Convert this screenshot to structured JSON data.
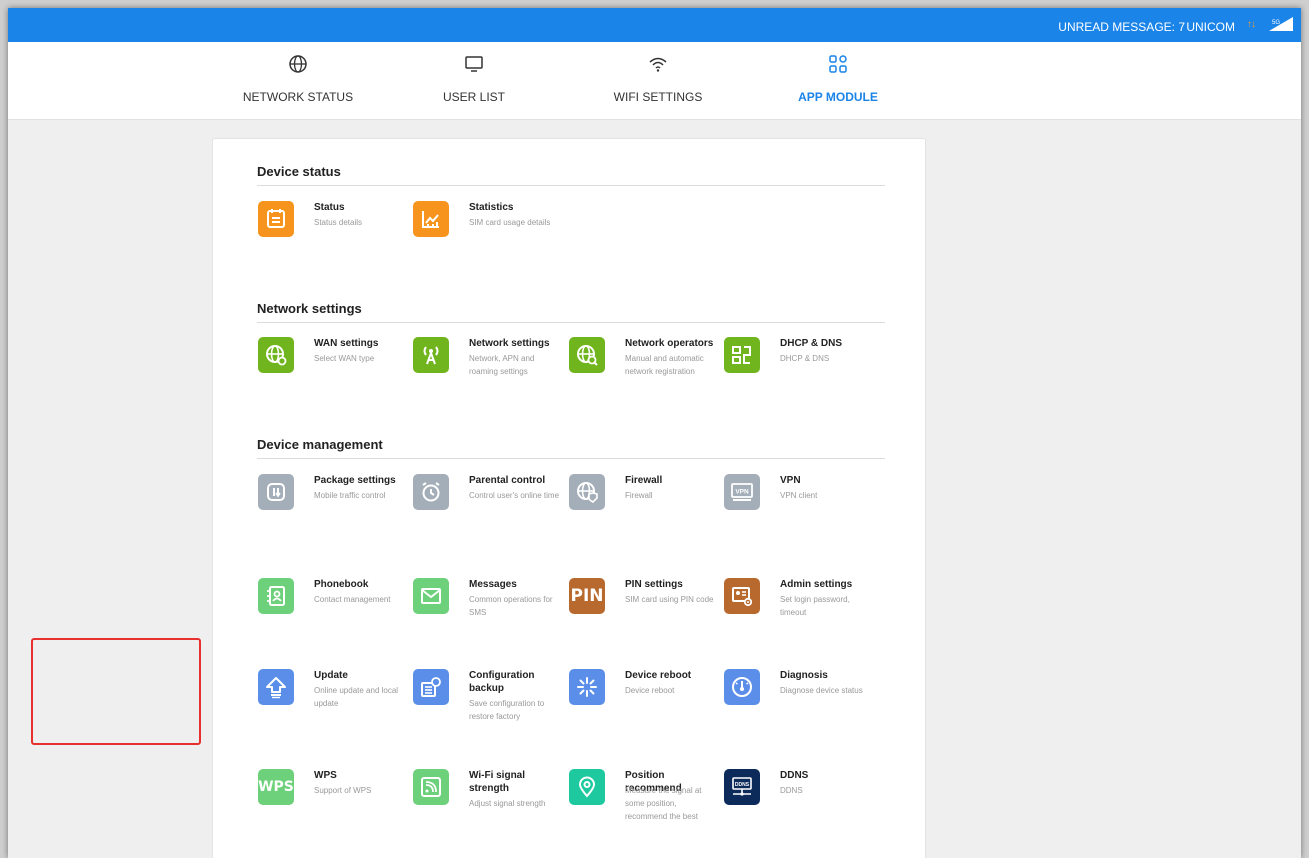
{
  "topbar": {
    "unread_message": "UNREAD MESSAGE: 7",
    "carrier": "UNICOM",
    "network_type": "5G",
    "bg_color": "#1a84e8"
  },
  "nav": {
    "items": [
      {
        "label": "NETWORK STATUS",
        "icon": "globe-icon",
        "active": false
      },
      {
        "label": "USER LIST",
        "icon": "monitor-icon",
        "active": false
      },
      {
        "label": "WIFI SETTINGS",
        "icon": "wifi-icon",
        "active": false
      },
      {
        "label": "APP MODULE",
        "icon": "app-grid-icon",
        "active": true
      }
    ]
  },
  "sections": [
    {
      "title": "Device status",
      "apps": [
        {
          "title": "Status",
          "desc": "Status details",
          "icon": "calendar-list-icon",
          "color": "#f7941d"
        },
        {
          "title": "Statistics",
          "desc": "SIM card usage details",
          "icon": "chart-icon",
          "color": "#f7941d"
        }
      ]
    },
    {
      "title": "Network settings",
      "apps": [
        {
          "title": "WAN settings",
          "desc": "Select WAN type",
          "icon": "globe-settings-icon",
          "color": "#70b41e"
        },
        {
          "title": "Network settings",
          "desc": "Network, APN and roaming settings",
          "icon": "antenna-icon",
          "color": "#70b41e"
        },
        {
          "title": "Network operators",
          "desc": "Manual and automatic network registration",
          "icon": "globe-search-icon",
          "color": "#70b41e"
        },
        {
          "title": "DHCP & DNS",
          "desc": "DHCP & DNS",
          "icon": "dhcp-icon",
          "color": "#70b41e"
        }
      ]
    },
    {
      "title": "Device management",
      "apps": [
        {
          "title": "Package settings",
          "desc": "Mobile traffic control",
          "icon": "package-icon",
          "color": "#a4aeb8"
        },
        {
          "title": "Parental control",
          "desc": "Control user's online time",
          "icon": "alarm-clock-icon",
          "color": "#a4aeb8"
        },
        {
          "title": "Firewall",
          "desc": "Firewall",
          "icon": "firewall-icon",
          "color": "#a4aeb8"
        },
        {
          "title": "VPN",
          "desc": "VPN client",
          "icon": "vpn-icon",
          "color": "#a4aeb8",
          "badge": "VPN"
        },
        {
          "title": "Phonebook",
          "desc": "Contact management",
          "icon": "phonebook-icon",
          "color": "#6dd07a"
        },
        {
          "title": "Messages",
          "desc": "Common operations for SMS",
          "icon": "envelope-icon",
          "color": "#6dd07a"
        },
        {
          "title": "PIN settings",
          "desc": "SIM card using PIN code",
          "icon": "pin-icon",
          "color": "#b86a2e",
          "badge": "PIN"
        },
        {
          "title": "Admin settings",
          "desc": "Set login password, timeout",
          "icon": "admin-icon",
          "color": "#b86a2e"
        },
        {
          "title": "Update",
          "desc": "Online update and local update",
          "icon": "upload-arrow-icon",
          "color": "#5b8ee8"
        },
        {
          "title": "Configuration backup",
          "desc": "Save configuration to restore factory",
          "icon": "backup-icon",
          "color": "#5b8ee8"
        },
        {
          "title": "Device reboot",
          "desc": "Device reboot",
          "icon": "reboot-icon",
          "color": "#5b8ee8"
        },
        {
          "title": "Diagnosis",
          "desc": "Diagnose device status",
          "icon": "diagnosis-icon",
          "color": "#5b8ee8"
        },
        {
          "title": "WPS",
          "desc": "Support of WPS",
          "icon": "wps-icon",
          "color": "#6dd07a",
          "badge": "WPS"
        },
        {
          "title": "Wi-Fi signal strength",
          "desc": "Adjust signal strength",
          "icon": "wifi-signal-icon",
          "color": "#6dd07a"
        },
        {
          "title": "Position recommend",
          "desc": "Measure the signal at some position, recommend the best",
          "icon": "location-pin-icon",
          "color": "#1ec9a0"
        },
        {
          "title": "DDNS",
          "desc": "DDNS",
          "icon": "ddns-icon",
          "color": "#0d2b5a",
          "badge": "DDNS"
        }
      ]
    }
  ]
}
